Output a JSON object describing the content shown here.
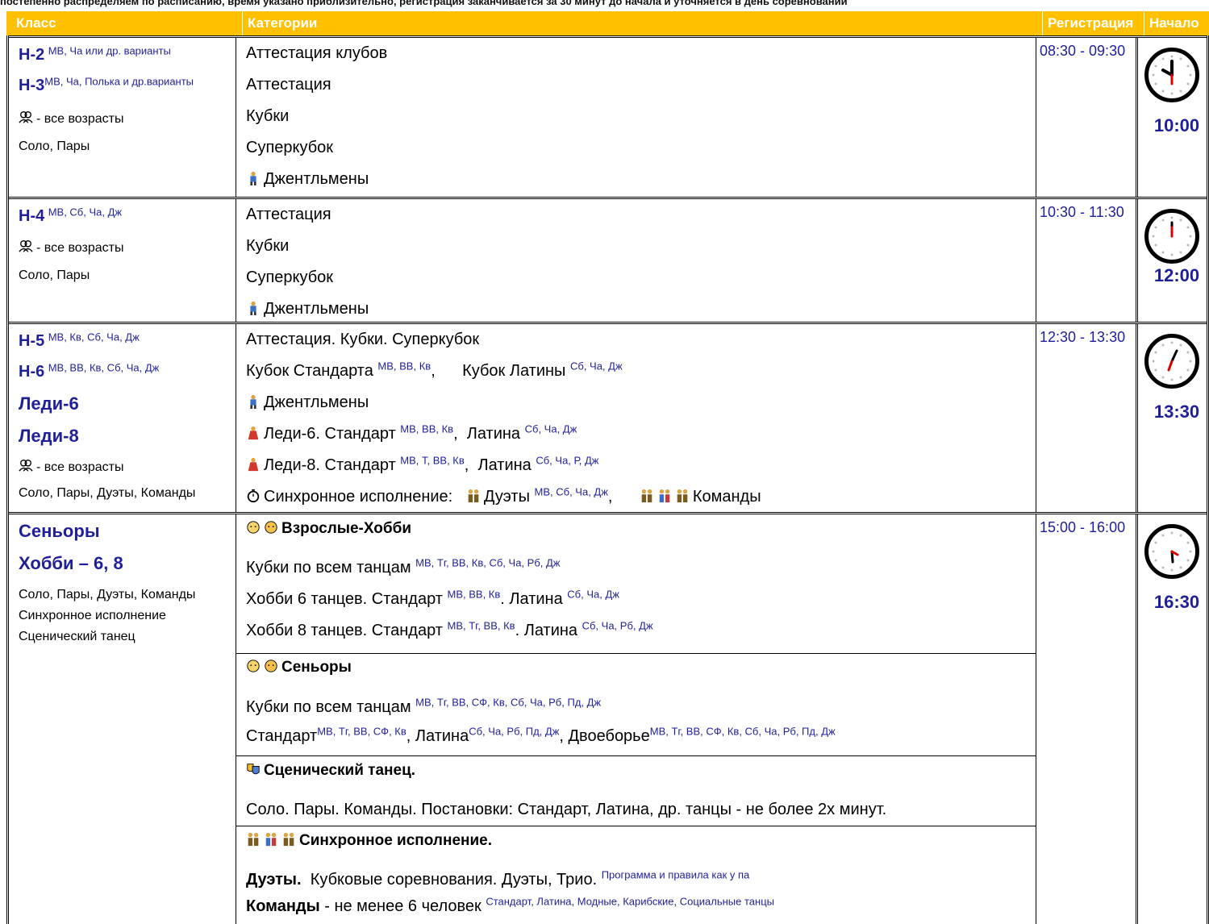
{
  "topline": "постепенно распределяем по расписанию, время указано приблизительно, регистрация заканчивается за 30 минут до начала и уточняется в день соревнований",
  "header": {
    "class": "Класс",
    "categories": "Категории",
    "registration": "Регистрация",
    "start": "Начало"
  },
  "blocks": [
    {
      "class_lines": [
        {
          "code": "Н-2",
          "sup": "МВ, Ча или др. варианты"
        },
        {
          "code": "Н-3",
          "sup": "МВ, Ча, Полька и др.варианты"
        }
      ],
      "ages": "- все возрасты",
      "formats": "Соло, Пары",
      "categories": [
        "Аттестация клубов",
        "Аттестация",
        "Кубки",
        "Суперкубок",
        "Джентльмены"
      ],
      "registration": "08:30 - 09:30",
      "start": "10:00"
    },
    {
      "class_lines": [
        {
          "code": "Н-4",
          "sup": "МВ, Сб, Ча, Дж"
        }
      ],
      "ages": "- все возрасты",
      "formats": "Соло, Пары",
      "categories": [
        "Аттестация",
        "Кубки",
        "Суперкубок",
        "Джентльмены"
      ],
      "registration": "10:30 - 11:30",
      "start": "12:00"
    },
    {
      "class_lines": [
        {
          "code": "Н-5",
          "sup": "МВ, Кв, Сб, Ча, Дж"
        },
        {
          "code": "Н-6",
          "sup": "МВ, ВВ, Кв, Сб, Ча, Дж"
        },
        {
          "code": "Леди-6",
          "sup": ""
        },
        {
          "code": "Леди-8",
          "sup": ""
        }
      ],
      "ages": "- все возрасты",
      "formats": "Соло, Пары, Дуэты, Команды",
      "categories": {
        "c1": "Аттестация. Кубки. Суперкубок",
        "c2a": "Кубок Стандарта",
        "c2a_sup": "МВ, ВВ, Кв",
        "c2b": "Кубок Латины",
        "c2b_sup": "Сб, Ча, Дж",
        "c3": "Джентльмены",
        "c4a": "Леди-6. Стандарт",
        "c4a_sup": "МВ, ВВ, Кв",
        "c4b": "Латина",
        "c4b_sup": "Сб, Ча, Дж",
        "c5a": "Леди-8. Стандарт",
        "c5a_sup": "МВ, Т, ВВ, Кв",
        "c5b": "Латина",
        "c5b_sup": "Сб, Ча, Р, Дж",
        "c6a": "Синхронное исполнение:",
        "c6b": "Дуэты",
        "c6b_sup": "МВ, Сб, Ча, Дж",
        "c6c": "Команды"
      },
      "registration": "12:30 - 13:30",
      "start": "13:30"
    },
    {
      "class_lines": [
        {
          "code": "Сеньоры",
          "sup": ""
        },
        {
          "code": "Хобби – 6, 8",
          "sup": ""
        }
      ],
      "formats": "Соло, Пары, Дуэты, Команды",
      "extra1": "Синхронное исполнение",
      "extra2": "Сценический танец",
      "sections": {
        "s1_head": "Взрослые-Хобби",
        "s1_l1": "Кубки по всем танцам",
        "s1_l1_sup": "МВ, Тг, ВВ, Кв,  Сб, Ча, Рб, Дж",
        "s1_l2a": "Хобби 6 танцев. Стандарт",
        "s1_l2a_sup": "МВ, ВВ, Кв",
        "s1_l2b": "Латина",
        "s1_l2b_sup": "Сб, Ча, Дж",
        "s1_l3a": "Хобби 8 танцев. Стандарт",
        "s1_l3a_sup": "МВ, Тг, ВВ, Кв",
        "s1_l3b": "Латина",
        "s1_l3b_sup": "Сб, Ча, Рб, Дж",
        "s2_head": "Сеньоры",
        "s2_l1": "Кубки по всем танцам",
        "s2_l1_sup": "МВ, Тг, ВВ, СФ, Кв,  Сб, Ча, Рб, Пд, Дж",
        "s2_l2a": "Стандарт",
        "s2_l2a_sup": "МВ, Тг, ВВ, СФ, Кв",
        "s2_l2b": "Латина",
        "s2_l2b_sup": "Сб, Ча, Рб, Пд, Дж",
        "s2_l2c": "Двоеборье",
        "s2_l2c_sup": "МВ, Тг, ВВ, СФ, Кв,  Сб, Ча, Рб, Пд, Дж",
        "s3_head": "Сценический танец.",
        "s3_l1": "Соло. Пары. Команды. Постановки: Стандарт, Латина, др. танцы - не более 2х минут.",
        "s4_head": "Синхронное исполнение.",
        "s4_l1a": "Дуэты.",
        "s4_l1b": "Кубковые соревнования. Дуэты, Трио.",
        "s4_l1_sup": "Программа и правила как у па",
        "s4_l2a": "Команды",
        "s4_l2b": "- не менее 6 человек",
        "s4_l2_sup": "Стандарт, Латина, Модные, Карибские, Социальные танцы"
      },
      "registration": "15:00 - 16:00",
      "start": "16:30"
    }
  ],
  "colors": {
    "header_bg": "#FFC000",
    "accent_text": "#1f1f9a"
  }
}
